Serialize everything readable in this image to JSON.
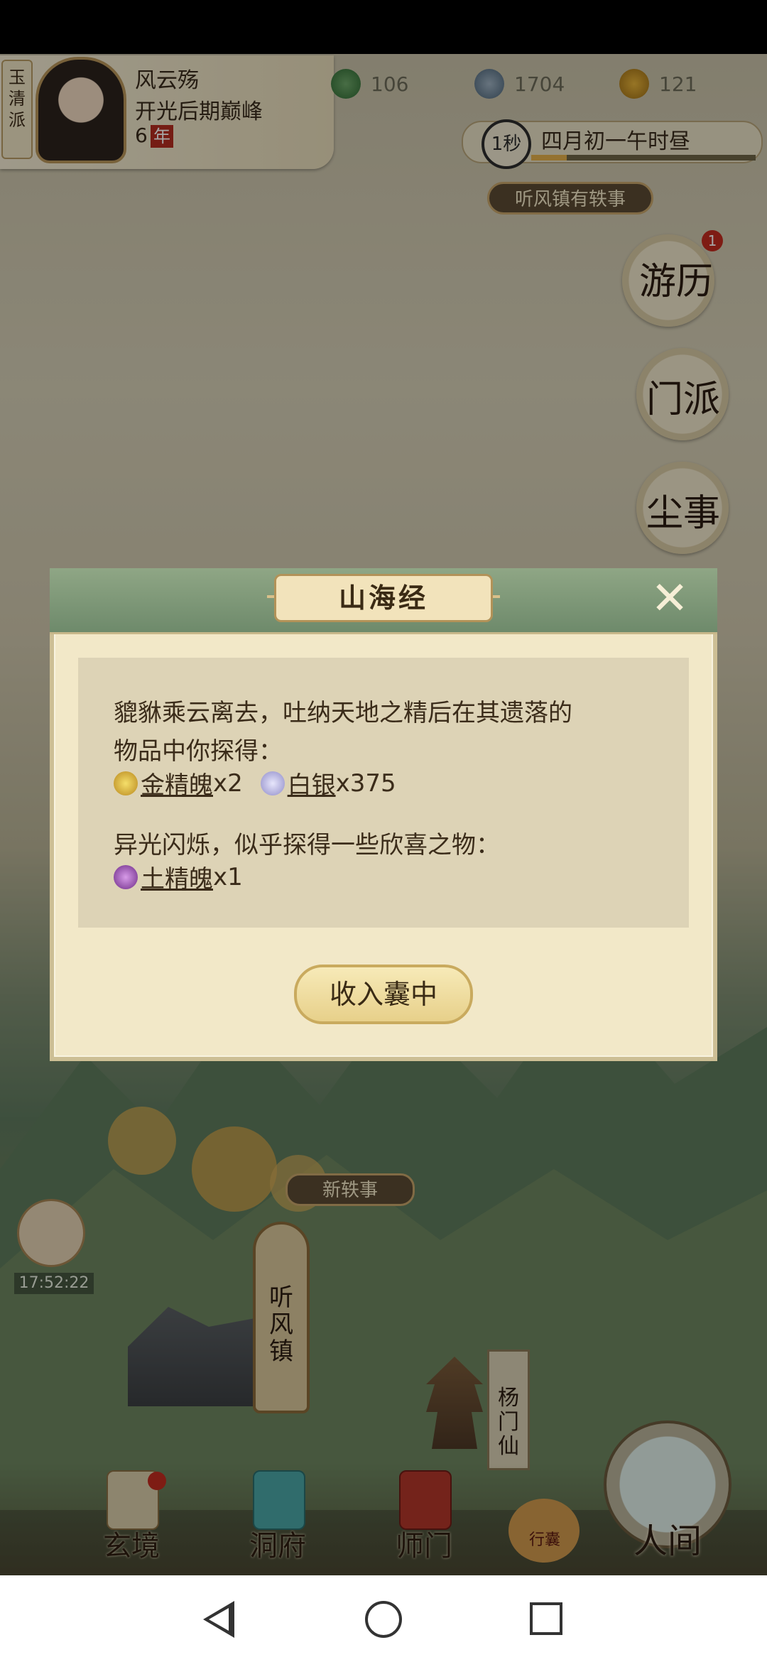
{
  "hud": {
    "sect": "玉清派",
    "player_name": "风云殇",
    "realm": "开光后期巅峰",
    "age": "6",
    "age_unit": "年",
    "resources": [
      {
        "icon": "jade-icon",
        "value": "106"
      },
      {
        "icon": "coin-icon",
        "value": "1704"
      },
      {
        "icon": "gold-figure-icon",
        "value": "121"
      }
    ],
    "clock_label": "1秒",
    "time_text": "四月初一午时昼",
    "event_tag": "听风镇有轶事"
  },
  "side_menu": {
    "travel": {
      "label": "游历",
      "badge": "1"
    },
    "sect": {
      "label": "门派"
    },
    "worldly": {
      "label": "尘事"
    }
  },
  "map": {
    "new_event": "新轶事",
    "town_label": "听风镇",
    "timer": "17:52:22",
    "yang_label": "杨门仙"
  },
  "bottom_nav": {
    "items": [
      {
        "label": "玄境"
      },
      {
        "label": "洞府"
      },
      {
        "label": "师门"
      }
    ],
    "bag_label": "行囊",
    "human_label": "人间"
  },
  "dialog": {
    "title": "山海经",
    "close_symbol": "✕",
    "line1": "貔貅乘云离去，吐纳天地之精后在其遗落的",
    "line2": "物品中你探得：",
    "rewards1": [
      {
        "name": "金精魄",
        "qty": "x2",
        "color": "#d8b330"
      },
      {
        "name": "白银",
        "qty": "x375",
        "color": "#b9b6e0"
      }
    ],
    "line3": "异光闪烁，似乎探得一些欣喜之物：",
    "rewards2": [
      {
        "name": "土精魄",
        "qty": "x1",
        "color": "#8e44ad"
      }
    ],
    "button": "收入囊中"
  }
}
